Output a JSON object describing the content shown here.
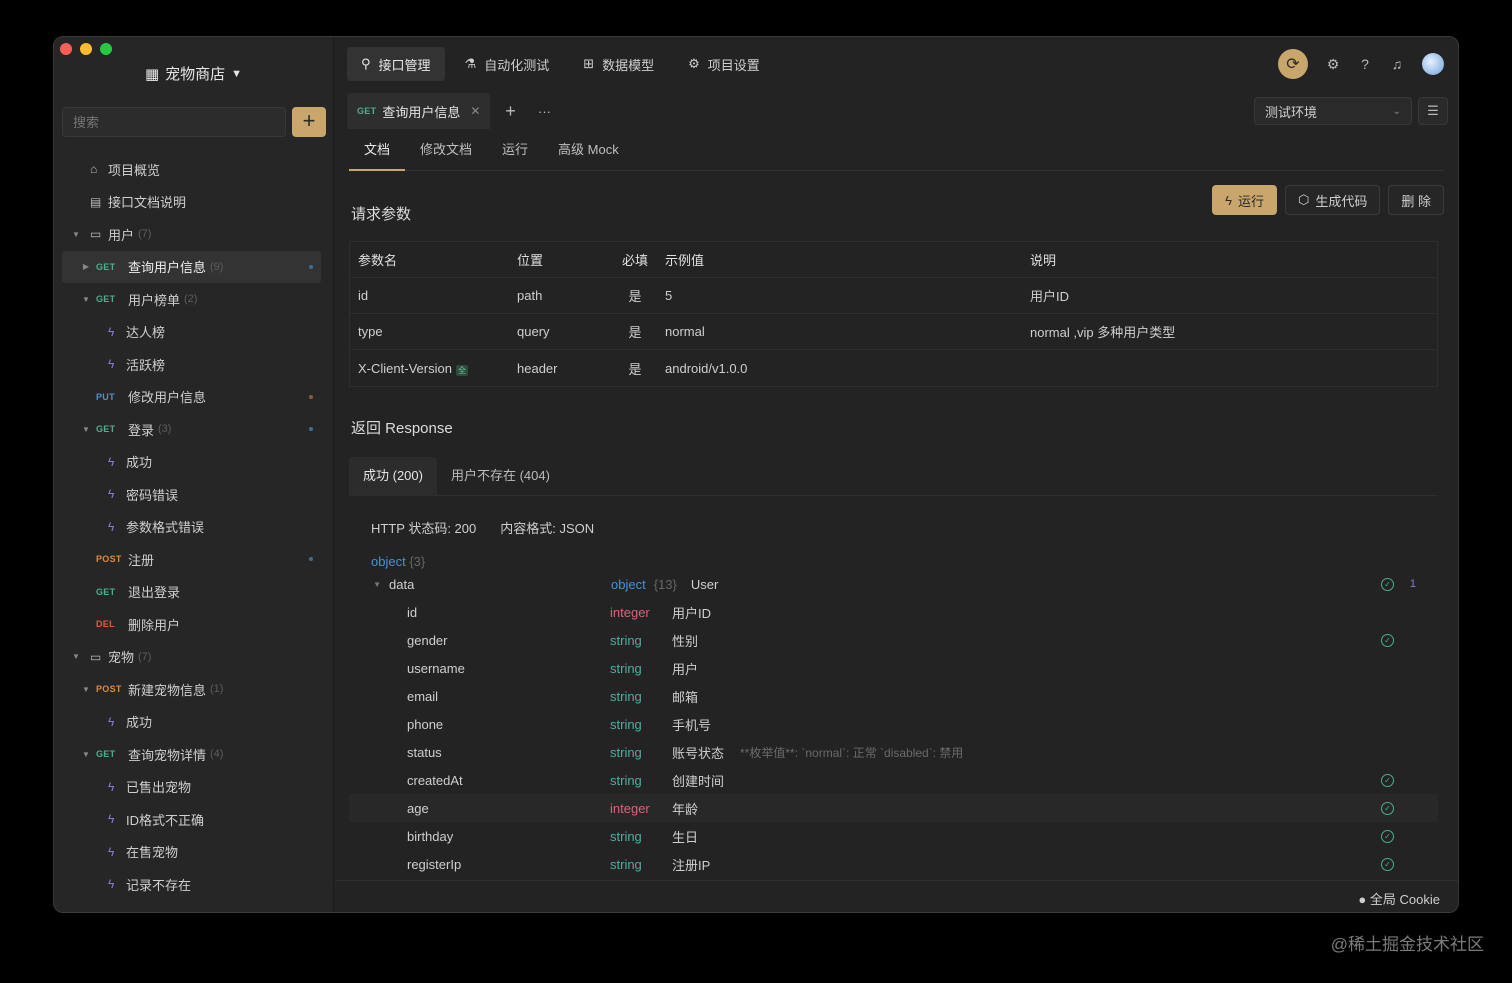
{
  "project": {
    "name": "宠物商店"
  },
  "search": {
    "placeholder": "搜索"
  },
  "tree": {
    "overview": "项目概览",
    "doc_desc": "接口文档说明",
    "folder_user": {
      "label": "用户",
      "count": "(7)"
    },
    "get_user": {
      "method": "GET",
      "label": "查询用户信息",
      "count": "(9)"
    },
    "get_rank": {
      "method": "GET",
      "label": "用户榜单",
      "count": "(2)"
    },
    "case_daren": "达人榜",
    "case_active": "活跃榜",
    "put_user": {
      "method": "PUT",
      "label": "修改用户信息"
    },
    "get_login": {
      "method": "GET",
      "label": "登录",
      "count": "(3)"
    },
    "case_success": "成功",
    "case_pwd": "密码错误",
    "case_fmt": "参数格式错误",
    "post_reg": {
      "method": "POST",
      "label": "注册"
    },
    "get_logout": {
      "method": "GET",
      "label": "退出登录"
    },
    "del_user": {
      "method": "DEL",
      "label": "删除用户"
    },
    "folder_pet": {
      "label": "宠物",
      "count": "(7)"
    },
    "post_pet": {
      "method": "POST",
      "label": "新建宠物信息",
      "count": "(1)"
    },
    "case_pet_success": "成功",
    "get_pet": {
      "method": "GET",
      "label": "查询宠物详情",
      "count": "(4)"
    },
    "case_sold": "已售出宠物",
    "case_id": "ID格式不正确",
    "case_onsale": "在售宠物",
    "case_none": "记录不存在"
  },
  "topnav": [
    "接口管理",
    "自动化测试",
    "数据模型",
    "项目设置"
  ],
  "doctab": {
    "method": "GET",
    "label": "查询用户信息",
    "more": "···"
  },
  "env": {
    "value": "测试环境"
  },
  "subtabs": [
    "文档",
    "修改文档",
    "运行",
    "高级 Mock"
  ],
  "actions": {
    "run": "运行",
    "gen": "生成代码",
    "del": "删 除"
  },
  "params": {
    "title": "请求参数",
    "headers": [
      "参数名",
      "位置",
      "必填",
      "示例值",
      "说明"
    ],
    "rows": [
      {
        "name": "id",
        "pos": "path",
        "req": "是",
        "example": "5",
        "desc": "用户ID"
      },
      {
        "name": "type",
        "pos": "query",
        "req": "是",
        "example": "normal",
        "desc": "normal ,vip 多种用户类型"
      },
      {
        "name": "X-Client-Version",
        "tag": "全",
        "pos": "header",
        "req": "是",
        "example": "android/v1.0.0",
        "desc": ""
      }
    ]
  },
  "response": {
    "title": "返回 Response",
    "tabs": [
      "成功 (200)",
      "用户不存在 (404)"
    ],
    "status": "HTTP 状态码: 200",
    "format": "内容格式: JSON",
    "root_type": "object",
    "root_count": "{3}",
    "data": {
      "name": "data",
      "type": "object",
      "count": "{13}",
      "ref": "User",
      "badge": "1"
    },
    "fields": [
      {
        "name": "id",
        "type": "integer",
        "desc": "用户ID",
        "check": false
      },
      {
        "name": "gender",
        "type": "string",
        "desc": "性别",
        "check": true
      },
      {
        "name": "username",
        "type": "string",
        "desc": "用户",
        "check": false
      },
      {
        "name": "email",
        "type": "string",
        "desc": "邮箱",
        "check": false
      },
      {
        "name": "phone",
        "type": "string",
        "desc": "手机号",
        "check": false
      },
      {
        "name": "status",
        "type": "string",
        "desc": "账号状态",
        "note": "**枚举值**: `normal`: 正常 `disabled`: 禁用",
        "check": false
      },
      {
        "name": "createdAt",
        "type": "string",
        "desc": "创建时间",
        "check": true
      },
      {
        "name": "age",
        "type": "integer",
        "desc": "年龄",
        "check": true
      },
      {
        "name": "birthday",
        "type": "string",
        "desc": "生日",
        "check": true
      },
      {
        "name": "registerIp",
        "type": "string",
        "desc": "注册IP",
        "check": true
      }
    ]
  },
  "statusbar": {
    "cookie": "全局 Cookie"
  },
  "watermark": "@稀土掘金技术社区",
  "colors": {
    "accent": "#c9a66b",
    "get": "#4caf8d",
    "put": "#4a90d9",
    "post": "#e0873a",
    "del": "#e05a4a"
  }
}
